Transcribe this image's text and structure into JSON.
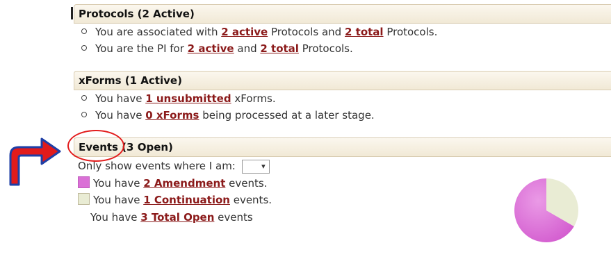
{
  "protocols": {
    "header": "Protocols (2 Active)",
    "items": [
      {
        "pre": "You are associated with ",
        "link1": "2 active",
        "mid": " Protocols and ",
        "link2": "2 total",
        "post": " Protocols."
      },
      {
        "pre": "You are the PI for ",
        "link1": "2 active",
        "mid": " and ",
        "link2": "2 total",
        "post": " Protocols."
      }
    ]
  },
  "xforms": {
    "header": "xForms (1 Active)",
    "items": [
      {
        "pre": "You have ",
        "link": "1 unsubmitted",
        "post": " xForms."
      },
      {
        "pre": "You have ",
        "link": "0 xForms",
        "post": " being processed at a later stage."
      }
    ]
  },
  "events": {
    "header": "Events (3 Open)",
    "filter_label": "Only show events where I am:",
    "filter_value": "",
    "legend": [
      {
        "pre": "You have ",
        "link": "2 Amendment",
        "post": " events.",
        "color": "#da70d6"
      },
      {
        "pre": "You have ",
        "link": "1 Continuation",
        "post": " events.",
        "color": "#e9ecd4"
      }
    ],
    "total": {
      "pre": "You have ",
      "link": "3 Total Open",
      "post": " events"
    }
  },
  "chart_data": {
    "type": "pie",
    "categories": [
      "Amendment",
      "Continuation"
    ],
    "values": [
      2,
      1
    ],
    "colors": [
      "#da70d6",
      "#e9ecd4"
    ]
  },
  "colors": {
    "link": "#8b1a1a",
    "annotation": "#e21b1b",
    "arrow_fill": "#e21b1b",
    "arrow_stroke": "#1f3fa6"
  }
}
